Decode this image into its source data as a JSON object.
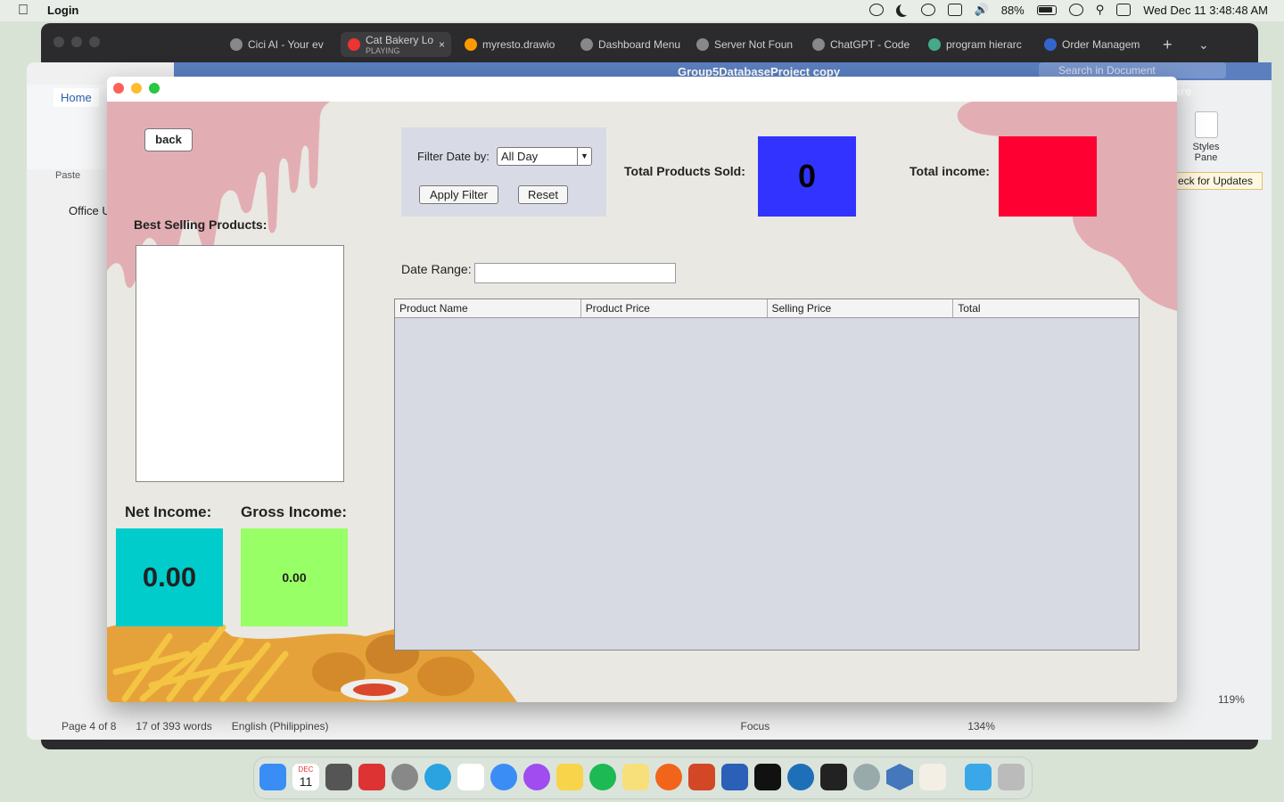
{
  "menubar": {
    "app_name": "Login",
    "battery": "88%",
    "datetime": "Wed Dec 11  3:48:48 AM"
  },
  "browser": {
    "tabs": [
      {
        "label": "Cici AI - Your ev"
      },
      {
        "label": "Cat Bakery Lo",
        "sub": "PLAYING"
      },
      {
        "label": "myresto.drawio"
      },
      {
        "label": "Dashboard Menu"
      },
      {
        "label": "Server Not Foun"
      },
      {
        "label": "ChatGPT - Code"
      },
      {
        "label": "program hierarc"
      },
      {
        "label": "Order Managem"
      }
    ]
  },
  "word": {
    "doc_title": "Group5DatabaseProject copy",
    "search_placeholder": "Search in Document",
    "home_tab": "Home",
    "paste": "Paste",
    "office_notice": "Office U",
    "share": "Share",
    "styles_pane": "Styles Pane",
    "updates": "eck for Updates",
    "status_page": "Page 4 of 8",
    "status_words": "17 of 393 words",
    "status_lang": "English (Philippines)",
    "status_focus": "Focus",
    "zoom": "134%",
    "zoom_right": "119%"
  },
  "app": {
    "back_label": "back",
    "filter": {
      "label": "Filter Date by:",
      "selected": "All Day",
      "apply_label": "Apply Filter",
      "reset_label": "Reset"
    },
    "total_sold_label": "Total Products Sold:",
    "total_sold_value": "0",
    "total_income_label": "Total income:",
    "total_income_value": "",
    "best_selling_label": "Best Selling Products:",
    "date_range_label": "Date Range:",
    "date_range_value": "",
    "table": {
      "columns": [
        "Product Name",
        "Product Price",
        "Selling Price",
        "Total"
      ],
      "rows": []
    },
    "net_income_label": "Net Income:",
    "net_income_value": "0.00",
    "gross_income_label": "Gross Income:",
    "gross_income_value": "0.00"
  },
  "colors": {
    "total_sold_box": "#3333ff",
    "total_income_box": "#ff0033",
    "net_income_box": "#00cccc",
    "gross_income_box": "#99ff66",
    "drip": "#e2aeb4"
  },
  "dock": {
    "calendar_day": "11",
    "calendar_month": "DEC"
  }
}
